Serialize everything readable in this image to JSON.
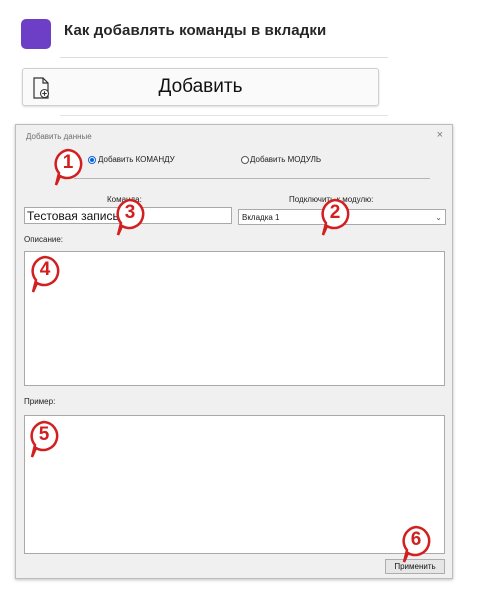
{
  "header": {
    "title": "Как добавлять команды в вкладки",
    "add_button_label": "Добавить"
  },
  "dialog": {
    "title": "Добавить данные",
    "close_glyph": "×",
    "radio_command_label": "Добавить КОМАНДУ",
    "radio_module_label": "Добавить МОДУЛЬ",
    "radio_selected": "command",
    "command_label": "Команда:",
    "command_value": "Тестовая запись",
    "module_label": "Подключить к модулю:",
    "module_selected": "Вкладка 1",
    "description_label": "Описание:",
    "example_label": "Пример:",
    "apply_button_label": "Применить"
  },
  "badges": [
    "1",
    "2",
    "3",
    "4",
    "5",
    "6"
  ],
  "colors": {
    "accent_purple": "#6c3fc6",
    "badge_red": "#d21f1f",
    "radio_blue": "#0b63d6",
    "dialog_bg": "#f0f0f0"
  },
  "icons": [
    "add-file-icon",
    "close-icon",
    "chevron-down-icon"
  ]
}
